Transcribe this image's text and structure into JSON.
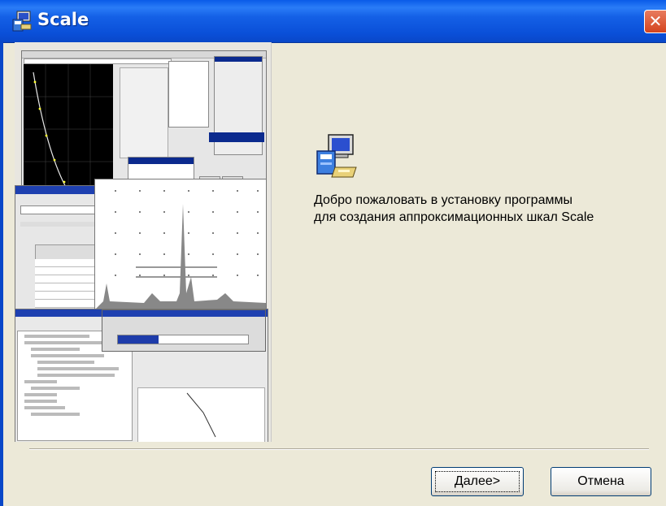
{
  "window": {
    "title": "Scale",
    "close_symbol": "✕",
    "title_icon": "installer-icon"
  },
  "banner": {
    "image": "wizard-banner-screenshots"
  },
  "content": {
    "icon": "computer-setup-icon",
    "welcome_line1": "Добро пожаловать в установку программы",
    "welcome_line2": "для создания аппроксимационных шкал Scale"
  },
  "buttons": {
    "next_underlined": "Д",
    "next_rest": "алее>",
    "cancel_label": "Отмена"
  },
  "colors": {
    "titlebar": "#0A4FD8",
    "close": "#D4441E",
    "dialog_bg": "#ECE9D8"
  }
}
